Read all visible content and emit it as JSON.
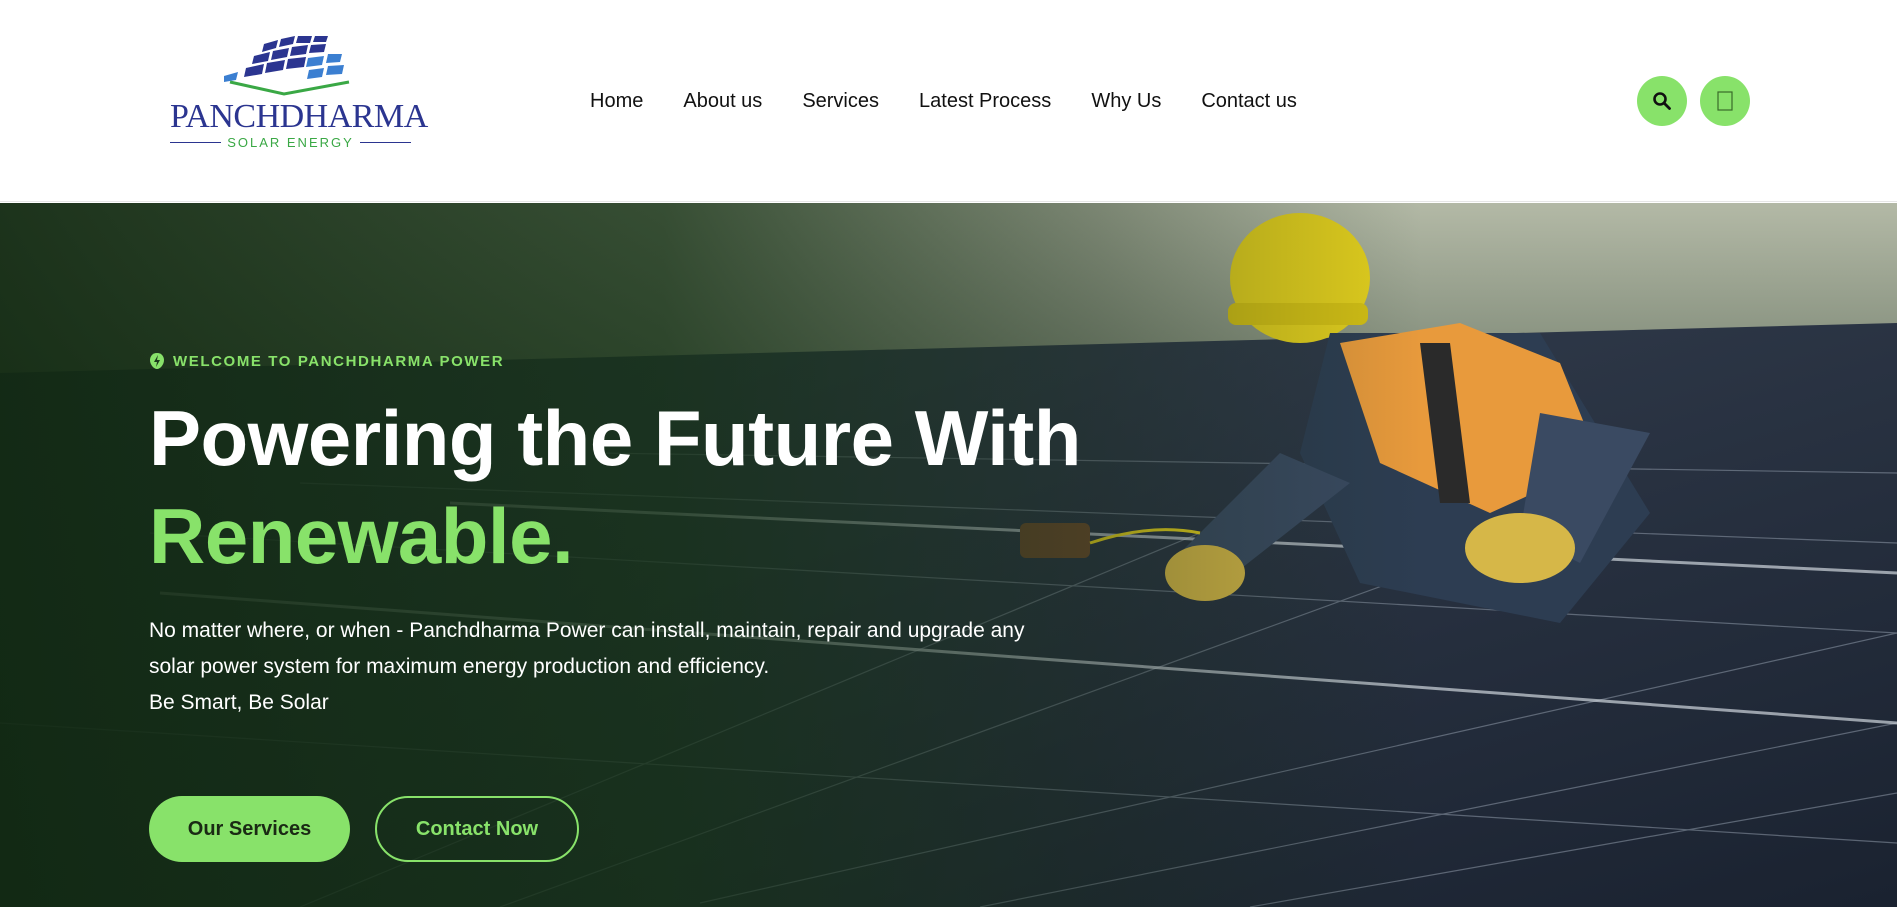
{
  "brand": {
    "name": "PANCHDHARMA",
    "tagline": "SOLAR ENERGY",
    "logo_icon": "solar-panel-logo"
  },
  "nav": {
    "items": [
      {
        "label": "Home"
      },
      {
        "label": "About us"
      },
      {
        "label": "Services"
      },
      {
        "label": "Latest Process"
      },
      {
        "label": "Why Us"
      },
      {
        "label": "Contact us"
      }
    ]
  },
  "header_actions": {
    "search_icon": "search-icon",
    "menu_icon": "menu-icon"
  },
  "hero": {
    "kicker": "WELCOME TO PANCHDHARMA POWER",
    "title_line1": "Powering the Future With",
    "title_line2": "Renewable.",
    "description": "No matter where, or when - Panchdharma Power can install, maintain, repair and upgrade any solar power system for maximum energy production and efficiency.",
    "motto": "Be Smart, Be Solar",
    "primary_button": "Our Services",
    "secondary_button": "Contact Now"
  },
  "colors": {
    "accent": "#88e26a",
    "brand_blue": "#2b3590",
    "brand_green": "#3aa845"
  }
}
